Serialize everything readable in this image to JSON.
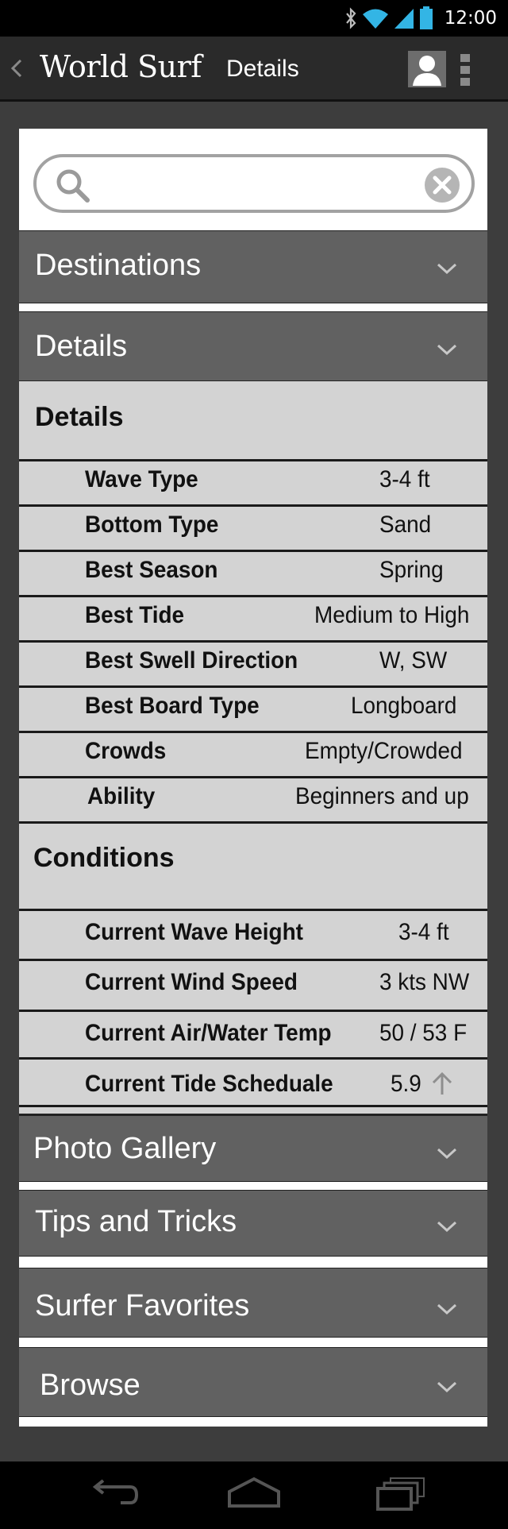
{
  "status_bar": {
    "time": "12:00",
    "icons": [
      "bluetooth-icon",
      "wifi-icon",
      "signal-icon",
      "battery-icon"
    ]
  },
  "action_bar": {
    "app_title": "World Surf",
    "screen_title": "Details",
    "icons": [
      "back-icon",
      "profile-icon",
      "overflow-menu-icon"
    ]
  },
  "search": {
    "value": "",
    "placeholder": ""
  },
  "sections": {
    "destinations": "Destinations",
    "details": "Details",
    "photo_gallery": "Photo Gallery",
    "tips_and_tricks": "Tips and Tricks",
    "surfer_favorites": "Surfer Favorites",
    "browse": "Browse"
  },
  "details": {
    "heading": "Details",
    "rows": [
      {
        "label": "Wave Type",
        "value": "3-4 ft"
      },
      {
        "label": "Bottom Type",
        "value": "Sand"
      },
      {
        "label": "Best Season",
        "value": "Spring"
      },
      {
        "label": "Best Tide",
        "value": "Medium to High"
      },
      {
        "label": "Best Swell Direction",
        "value": "W, SW"
      },
      {
        "label": "Best Board Type",
        "value": "Longboard"
      },
      {
        "label": "Crowds",
        "value": "Empty/Crowded"
      },
      {
        "label": "Ability",
        "value": "Beginners and up"
      }
    ]
  },
  "conditions": {
    "heading": "Conditions",
    "rows": [
      {
        "label": "Current Wave Height",
        "value": "3-4 ft"
      },
      {
        "label": "Current Wind Speed",
        "value": "3 kts NW"
      },
      {
        "label": "Current Air/Water Temp",
        "value": "50 / 53 F"
      },
      {
        "label": "Current Tide Scheduale",
        "value": "5.9",
        "trend_icon": "arrow-up-icon"
      }
    ]
  },
  "colors": {
    "section_header": "#616161",
    "detail_background": "#d3d3d3",
    "page_background": "#3d3d3d"
  }
}
